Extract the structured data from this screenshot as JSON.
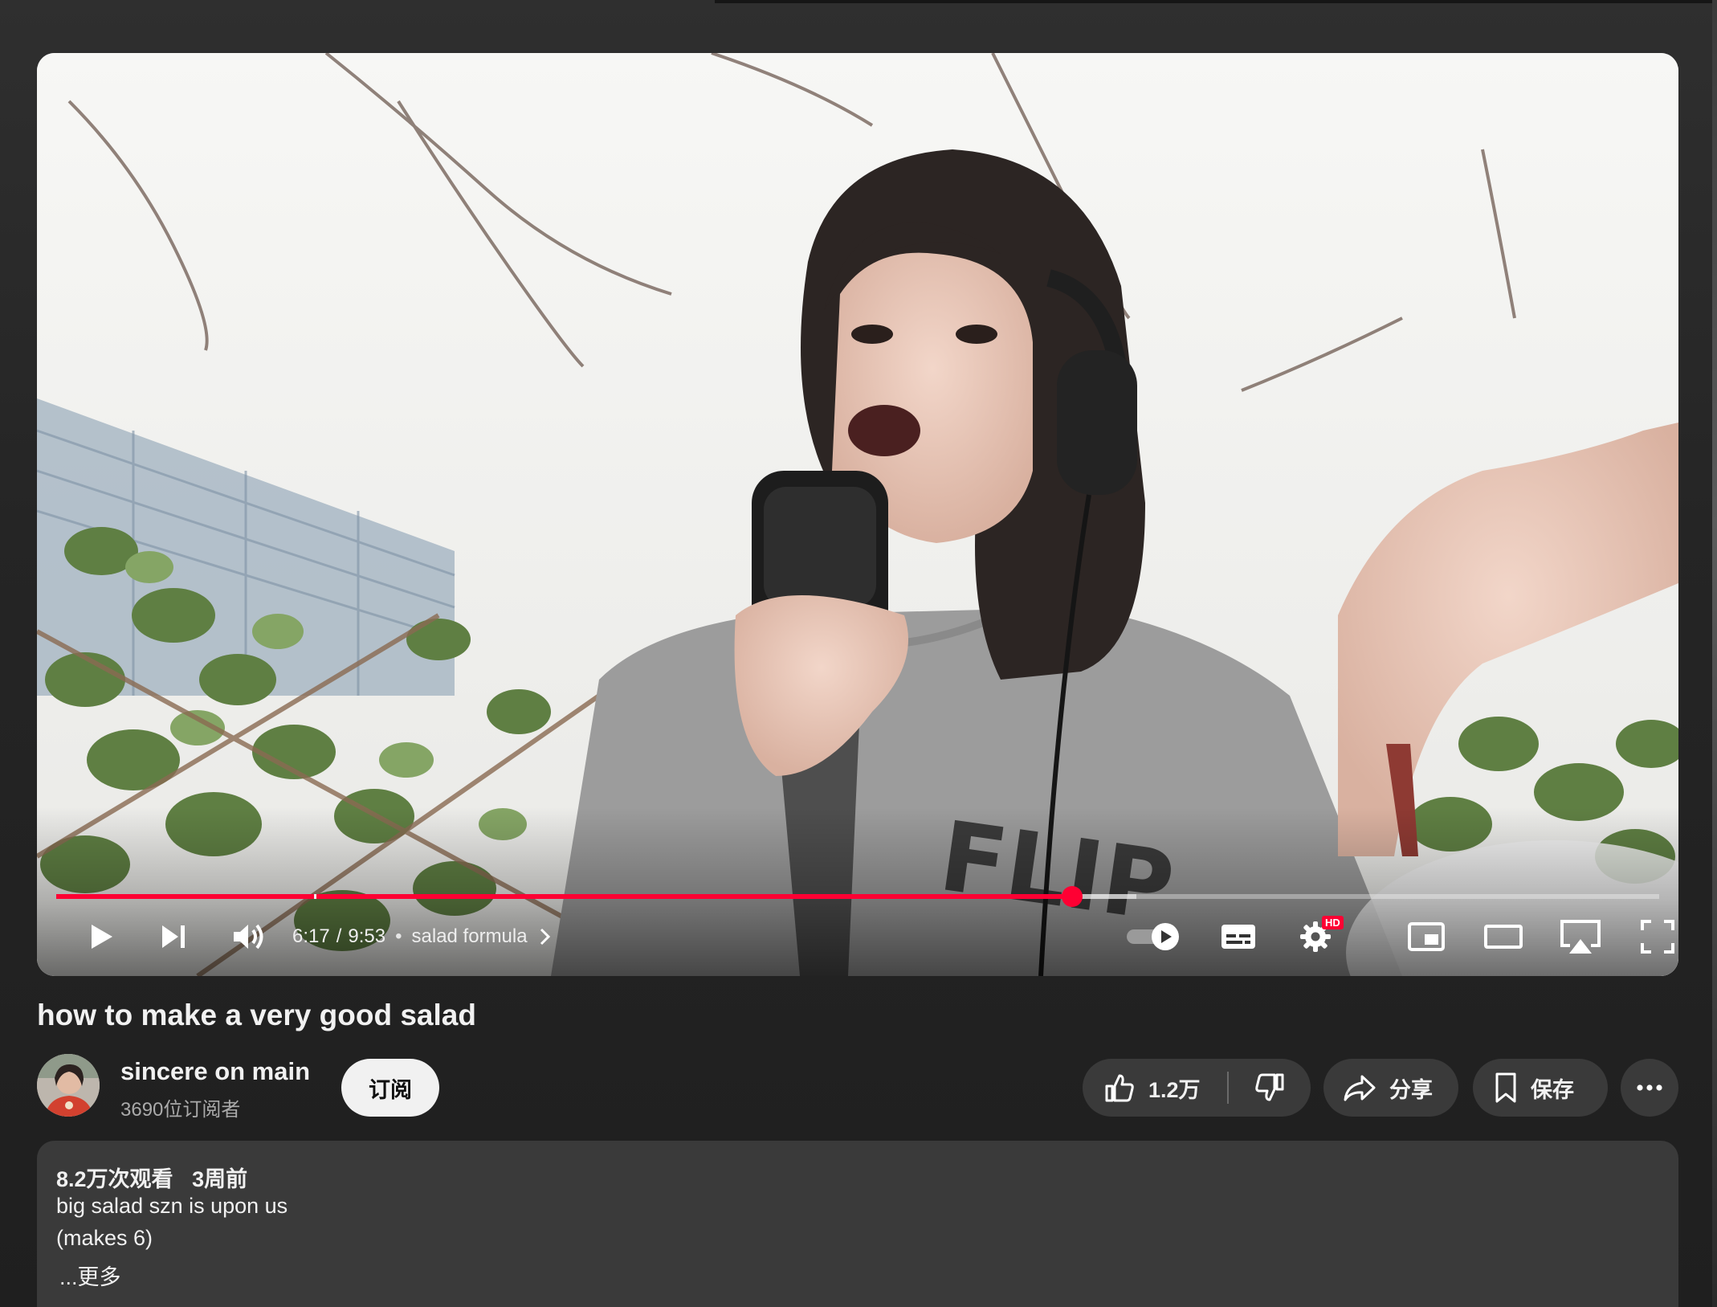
{
  "player": {
    "current_time": "6:17",
    "time_separator": "/",
    "duration": "9:53",
    "chapter_dot": "•",
    "chapter": "salad formula",
    "progress_fraction": 0.634,
    "buffered_fraction": 0.674,
    "chapter_marker_fraction": 0.161,
    "hd_badge": "HD",
    "accent_color": "#ff0033"
  },
  "video": {
    "title": "how to make a very good salad"
  },
  "channel": {
    "name": "sincere on main",
    "subscribers": "3690位订阅者",
    "subscribe_label": "订阅"
  },
  "actions": {
    "like_count": "1.2万",
    "share_label": "分享",
    "save_label": "保存"
  },
  "description": {
    "views": "8.2万次观看",
    "age": "3周前",
    "lines": [
      "big salad szn is upon us",
      "(makes 6)"
    ],
    "more_label": "...更多"
  },
  "icons": {
    "play": "play-icon",
    "next": "next-icon",
    "volume": "volume-icon",
    "chevron": "chevron-right-icon",
    "autoplay": "autoplay-toggle-icon",
    "subtitles": "subtitles-icon",
    "settings": "gear-icon",
    "miniplayer": "miniplayer-icon",
    "theater": "theater-mode-icon",
    "airplay": "airplay-icon",
    "fullscreen": "fullscreen-icon",
    "like": "thumbs-up-icon",
    "dislike": "thumbs-down-icon",
    "share": "share-arrow-icon",
    "save": "bookmark-icon",
    "more": "more-horizontal-icon"
  }
}
